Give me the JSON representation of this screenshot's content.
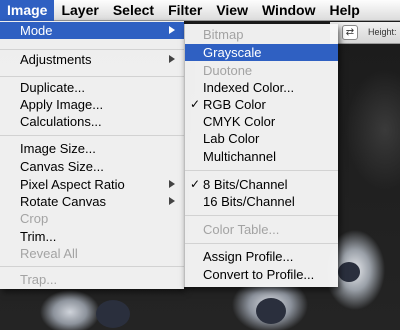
{
  "menubar": {
    "items": [
      "Image",
      "Layer",
      "Select",
      "Filter",
      "View",
      "Window",
      "Help"
    ]
  },
  "options_bar": {
    "label": "Height:",
    "icon": "swap-arrows-icon"
  },
  "image_menu": {
    "items": [
      {
        "label": "Mode",
        "submenu": true,
        "highlighted": true
      },
      {
        "label": "Adjustments",
        "submenu": true
      },
      {
        "label": "Duplicate..."
      },
      {
        "label": "Apply Image..."
      },
      {
        "label": "Calculations..."
      },
      {
        "label": "Image Size..."
      },
      {
        "label": "Canvas Size..."
      },
      {
        "label": "Pixel Aspect Ratio",
        "submenu": true
      },
      {
        "label": "Rotate Canvas",
        "submenu": true
      },
      {
        "label": "Crop",
        "disabled": true
      },
      {
        "label": "Trim..."
      },
      {
        "label": "Reveal All",
        "disabled": true
      },
      {
        "label": "Trap...",
        "disabled": true
      }
    ]
  },
  "mode_submenu": {
    "items": [
      {
        "label": "Bitmap",
        "disabled": true
      },
      {
        "label": "Grayscale",
        "highlighted": true
      },
      {
        "label": "Duotone",
        "disabled": true
      },
      {
        "label": "Indexed Color..."
      },
      {
        "label": "RGB Color",
        "checked": true
      },
      {
        "label": "CMYK Color"
      },
      {
        "label": "Lab Color"
      },
      {
        "label": "Multichannel"
      },
      {
        "label": "8 Bits/Channel",
        "checked": true
      },
      {
        "label": "16 Bits/Channel"
      },
      {
        "label": "Color Table...",
        "disabled": true
      },
      {
        "label": "Assign Profile..."
      },
      {
        "label": "Convert to Profile..."
      }
    ]
  },
  "colors": {
    "highlight": "#2f60c2",
    "disabled_text": "#a3a3a3"
  }
}
